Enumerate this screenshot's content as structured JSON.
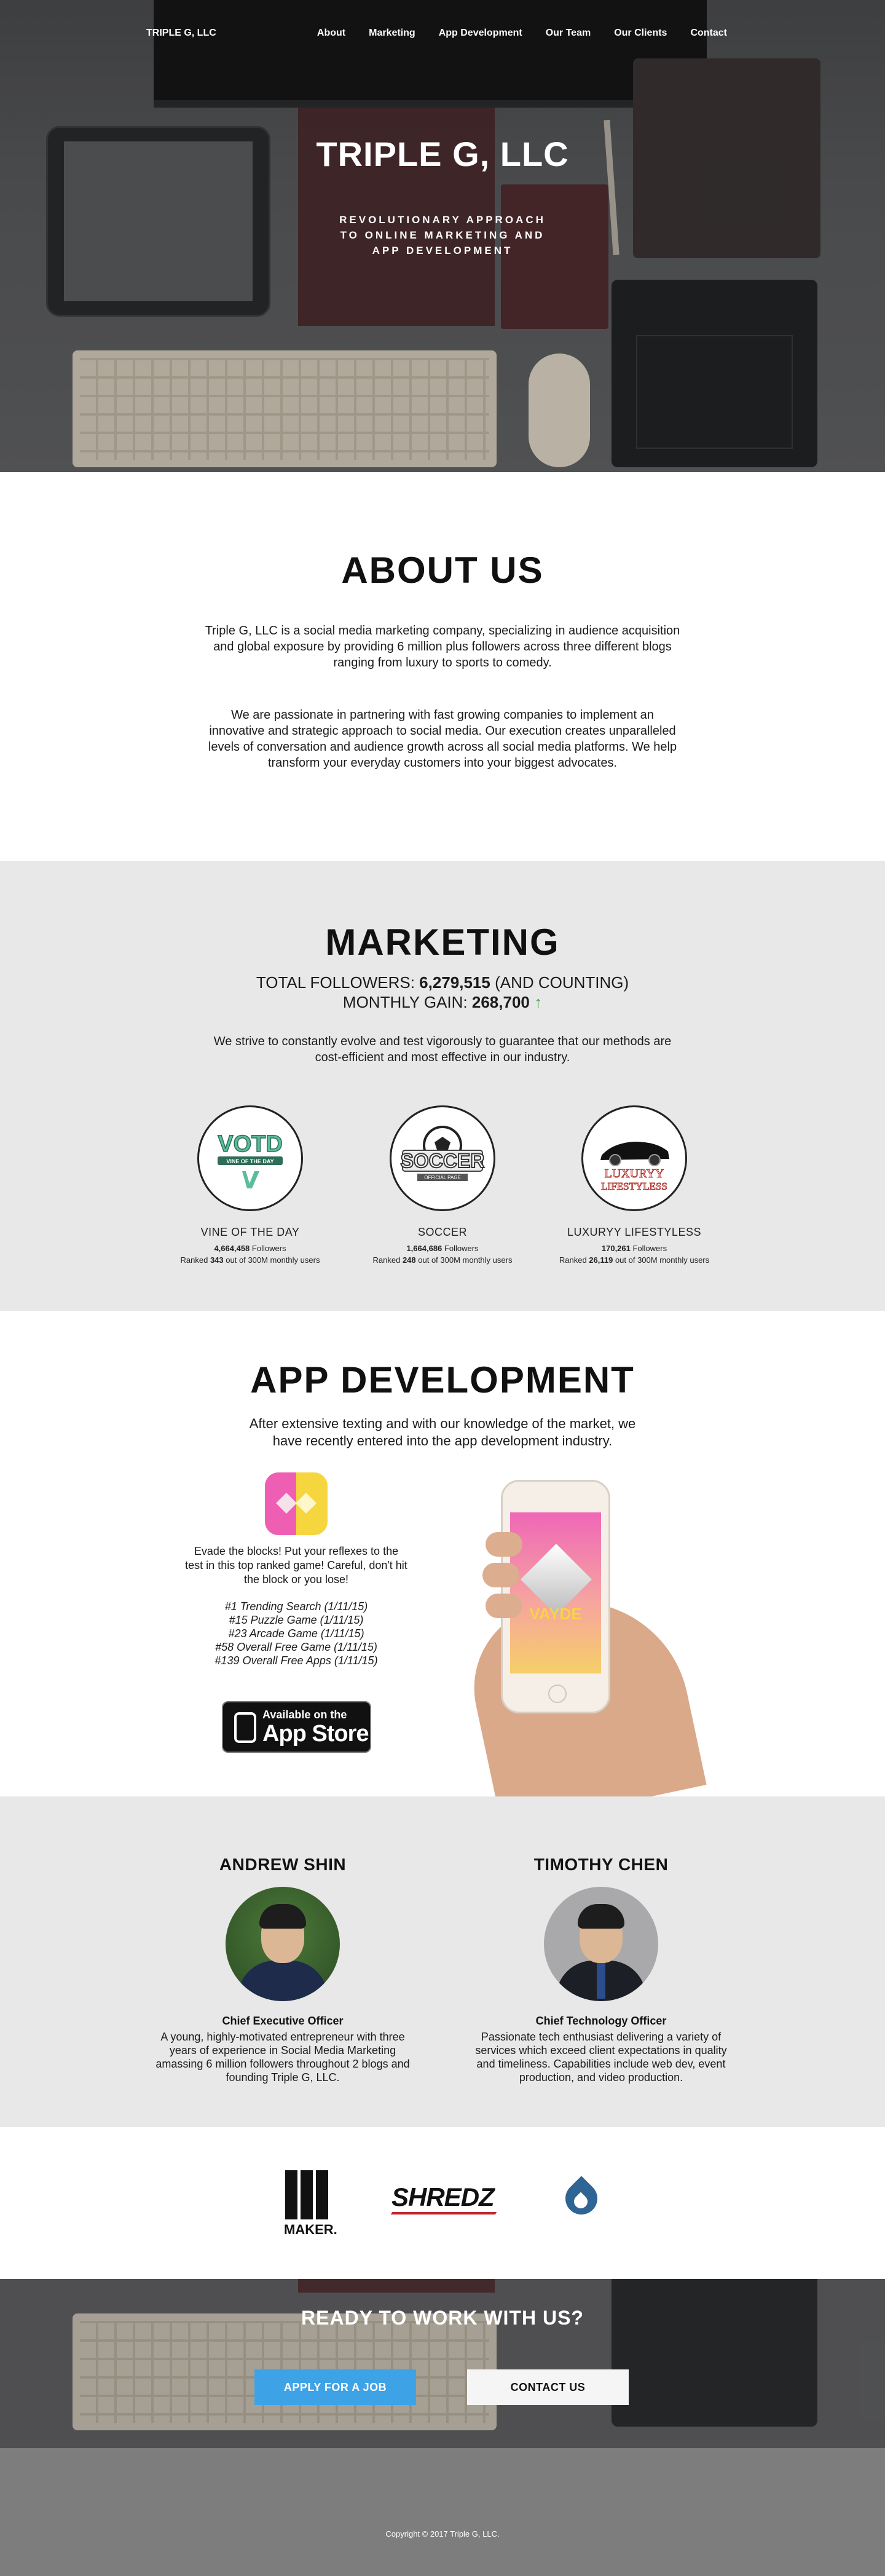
{
  "nav": {
    "brand": "TRIPLE G, LLC",
    "links": [
      "About",
      "Marketing",
      "App Development",
      "Our Team",
      "Our Clients",
      "Contact"
    ]
  },
  "hero": {
    "title": "TRIPLE G, LLC",
    "subtitle": "REVOLUTIONARY APPROACH TO ONLINE MARKETING AND APP DEVELOPMENT"
  },
  "about": {
    "title": "ABOUT US",
    "paragraph1": "Triple G, LLC is a social media marketing company, specializing in audience acquisition and global exposure by providing 6 million plus followers across three different blogs ranging from luxury to sports to comedy.",
    "paragraph2": "We are passionate in partnering with fast growing companies to implement an innovative and strategic approach to social media. Our execution creates unparalleled levels of conversation and audience growth across all social media platforms. We help transform your everyday customers into your biggest advocates."
  },
  "marketing": {
    "title": "MARKETING",
    "total_label": "TOTAL FOLLOWERS: ",
    "total_value": "6,279,515",
    "total_suffix": " (AND COUNTING)",
    "gain_label": "MONTHLY GAIN: ",
    "gain_value": "268,700",
    "gain_arrow": "↑",
    "description": "We strive to constantly evolve and test vigorously to guarantee that our methods are cost-efficient and most effective in our industry.",
    "blogs": [
      {
        "name": "VINE OF THE DAY",
        "logo": "VOTD",
        "logo_sub": "VINE OF THE DAY",
        "followers": "4,664,458",
        "followers_label": " Followers",
        "rank_pre": "Ranked ",
        "rank": "343",
        "rank_post": " out of 300M monthly users"
      },
      {
        "name": "SOCCER",
        "logo": "SOCCER",
        "logo_sub": "OFFICIAL PAGE",
        "followers": "1,664,686",
        "followers_label": " Followers",
        "rank_pre": "Ranked ",
        "rank": "248",
        "rank_post": " out of 300M monthly users"
      },
      {
        "name": "LUXURYY LIFESTYLESS",
        "logo": "LUXURYY",
        "logo_sub": "LIFESTYLESS",
        "followers": "170,261",
        "followers_label": " Followers",
        "rank_pre": "Ranked ",
        "rank": "26,119",
        "rank_post": " out of 300M monthly users"
      }
    ]
  },
  "appdev": {
    "title": "APP DEVELOPMENT",
    "intro": "After extensive texting and with our knowledge of the market, we have recently entered into the app development industry.",
    "app_description": "Evade the blocks! Put your reflexes to the test in this top ranked game! Careful, don't hit the block or you lose!",
    "rankings": [
      "#1 Trending Search (1/11/15)",
      "#15 Puzzle Game (1/11/15)",
      "#23 Arcade Game (1/11/15)",
      "#58 Overall Free Game (1/11/15)",
      "#139 Overall Free Apps (1/11/15)"
    ],
    "store_line1": "Available on the",
    "store_line2": "App Store",
    "phone_game_title": "VAYDE"
  },
  "team": {
    "members": [
      {
        "name": "ANDREW SHIN",
        "role": "Chief Executive Officer",
        "bio": "A young, highly-motivated entrepreneur with three years of experience in Social Media Marketing amassing 6 million followers throughout 2 blogs and founding Triple G, LLC."
      },
      {
        "name": "TIMOTHY CHEN",
        "role": "Chief Technology Officer",
        "bio": "Passionate tech enthusiast delivering a variety of services which exceed client expectations in quality and timeliness. Capabilities include web dev, event production, and video production."
      }
    ]
  },
  "clients": {
    "maker": "MAKER.",
    "shred": "SHREDZ"
  },
  "cta": {
    "title": "READY TO WORK WITH US?",
    "apply": "APPLY FOR A JOB",
    "contact": "CONTACT US"
  },
  "footer": {
    "copyright": "Copyright © 2017 Triple G, LLC."
  },
  "colors": {
    "accent_blue": "#3da3e6",
    "gain_green": "#2e9c3a",
    "section_gray": "#e8e8e8",
    "footer_gray": "#7d7d7d"
  }
}
